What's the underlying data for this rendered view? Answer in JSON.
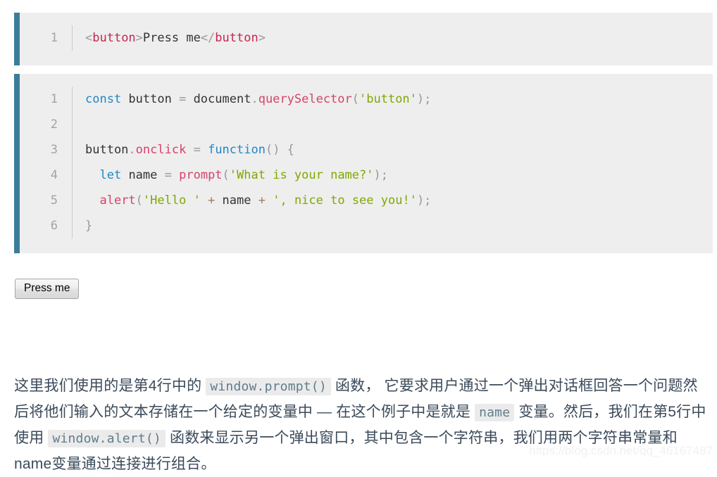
{
  "code_blocks": [
    {
      "id": "html-snippet",
      "language": "html",
      "line_numbers": [
        "1"
      ],
      "lines": [
        [
          {
            "text": "<",
            "type": "punc"
          },
          {
            "text": "button",
            "type": "tag"
          },
          {
            "text": ">",
            "type": "punc"
          },
          {
            "text": "Press me",
            "type": "plain"
          },
          {
            "text": "</",
            "type": "punc"
          },
          {
            "text": "button",
            "type": "tag"
          },
          {
            "text": ">",
            "type": "punc"
          }
        ]
      ],
      "plain_text": "<button>Press me</button>"
    },
    {
      "id": "js-snippet",
      "language": "javascript",
      "line_numbers": [
        "1",
        "2",
        "3",
        "4",
        "5",
        "6"
      ],
      "lines": [
        [
          {
            "text": "const",
            "type": "kw"
          },
          {
            "text": " button ",
            "type": "plain"
          },
          {
            "text": "=",
            "type": "punc"
          },
          {
            "text": " document",
            "type": "plain"
          },
          {
            "text": ".",
            "type": "punc"
          },
          {
            "text": "querySelector",
            "type": "fn"
          },
          {
            "text": "(",
            "type": "punc"
          },
          {
            "text": "'button'",
            "type": "str"
          },
          {
            "text": ");",
            "type": "punc"
          }
        ],
        [],
        [
          {
            "text": "button",
            "type": "plain"
          },
          {
            "text": ".",
            "type": "punc"
          },
          {
            "text": "onclick",
            "type": "fn"
          },
          {
            "text": " ",
            "type": "plain"
          },
          {
            "text": "=",
            "type": "punc"
          },
          {
            "text": " ",
            "type": "plain"
          },
          {
            "text": "function",
            "type": "kw"
          },
          {
            "text": "() {",
            "type": "punc"
          }
        ],
        [
          {
            "text": "  ",
            "type": "plain"
          },
          {
            "text": "let",
            "type": "kw"
          },
          {
            "text": " name ",
            "type": "plain"
          },
          {
            "text": "=",
            "type": "punc"
          },
          {
            "text": " ",
            "type": "plain"
          },
          {
            "text": "prompt",
            "type": "fn"
          },
          {
            "text": "(",
            "type": "punc"
          },
          {
            "text": "'What is your name?'",
            "type": "str"
          },
          {
            "text": ");",
            "type": "punc"
          }
        ],
        [
          {
            "text": "  ",
            "type": "plain"
          },
          {
            "text": "alert",
            "type": "fn"
          },
          {
            "text": "(",
            "type": "punc"
          },
          {
            "text": "'Hello '",
            "type": "str"
          },
          {
            "text": " ",
            "type": "plain"
          },
          {
            "text": "+",
            "type": "op"
          },
          {
            "text": " name ",
            "type": "plain"
          },
          {
            "text": "+",
            "type": "op"
          },
          {
            "text": " ",
            "type": "plain"
          },
          {
            "text": "', nice to see you!'",
            "type": "str"
          },
          {
            "text": ");",
            "type": "punc"
          }
        ],
        [
          {
            "text": "}",
            "type": "punc"
          }
        ]
      ],
      "plain_text": "const button = document.querySelector('button');\n\nbutton.onclick = function() {\n  let name = prompt('What is your name?');\n  alert('Hello ' + name + ', nice to see you!');\n}"
    }
  ],
  "demo": {
    "button_label": "Press me"
  },
  "explanation": {
    "segments": [
      {
        "kind": "text",
        "text": "这里我们使用的是第4行中的 "
      },
      {
        "kind": "code",
        "text": "window.prompt()"
      },
      {
        "kind": "text",
        "text": " 函数， 它要求用户通过一个弹出对话框回答一个问题然后将他们输入的文本存储在一个给定的变量中 — 在这个例子中是就是 "
      },
      {
        "kind": "code",
        "text": "name"
      },
      {
        "kind": "text",
        "text": " 变量。然后，我们在第5行中使用 "
      },
      {
        "kind": "code",
        "text": "window.alert()"
      },
      {
        "kind": "text",
        "text": " 函数来显示另一个弹出窗口，其中包含一个字符串，我们用两个字符串常量和name变量通过连接进行组合。"
      }
    ]
  },
  "watermark": {
    "text": "https://blog.csdn.net/qq_46167487"
  },
  "theme": {
    "code_background": "#eeeeee",
    "code_accent_border": "#3b7d99",
    "line_number_color": "#a3a3a3",
    "token_tag": "#c7254e",
    "token_keyword": "#1e88c7",
    "token_function": "#d5426a",
    "token_string": "#7fa800",
    "token_punctuation": "#999999",
    "text_color": "#3b4a5a",
    "inline_code_background": "#ebebeb",
    "inline_code_color": "#5f7c8c",
    "page_background": "#ffffff"
  }
}
